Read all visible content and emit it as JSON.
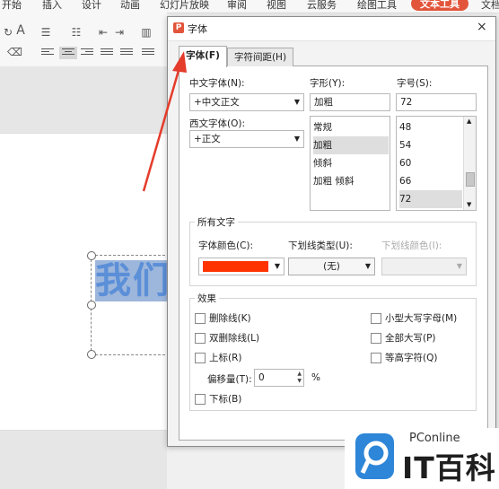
{
  "ribbon": {
    "tabs": [
      "开始",
      "插入",
      "设计",
      "动画",
      "幻灯片放映",
      "审阅",
      "视图",
      "云服务",
      "绘图工具",
      "文本工具",
      "文档"
    ],
    "font_icon": "A",
    "accent_tab_color": "#e2553b"
  },
  "slide": {
    "text": "我们"
  },
  "dialog": {
    "logo": "P",
    "title": "字体",
    "close": "×",
    "tabs": [
      "字体(F)",
      "字符间距(H)"
    ],
    "chinese_font": {
      "label": "中文字体(N):",
      "value": "+中文正文"
    },
    "western_font": {
      "label": "西文字体(O):",
      "value": "+正文"
    },
    "style": {
      "label": "字形(Y):",
      "value": "加粗",
      "options": [
        "常规",
        "加粗",
        "倾斜",
        "加粗 倾斜"
      ],
      "selected": "加粗"
    },
    "size": {
      "label": "字号(S):",
      "value": "72",
      "options": [
        "48",
        "54",
        "60",
        "66",
        "72"
      ],
      "selected": "72"
    },
    "all_text": {
      "title": "所有文字",
      "font_color_label": "字体颜色(C):",
      "font_color_value": "#ff3300",
      "underline_type_label": "下划线类型(U):",
      "underline_type_value": "(无)",
      "underline_color_label": "下划线颜色(I):"
    },
    "effects": {
      "title": "效果",
      "strikethrough": "删除线(K)",
      "double_strikethrough": "双删除线(L)",
      "superscript": "上标(R)",
      "offset_label": "偏移量(T):",
      "offset_value": "0",
      "offset_unit": "%",
      "subscript": "下标(B)",
      "small_caps": "小型大写字母(M)",
      "all_caps": "全部大写(P)",
      "equal_height": "等高字符(Q)"
    }
  },
  "watermark": {
    "brand_top": "PConline",
    "brand_main": "IT百科"
  }
}
